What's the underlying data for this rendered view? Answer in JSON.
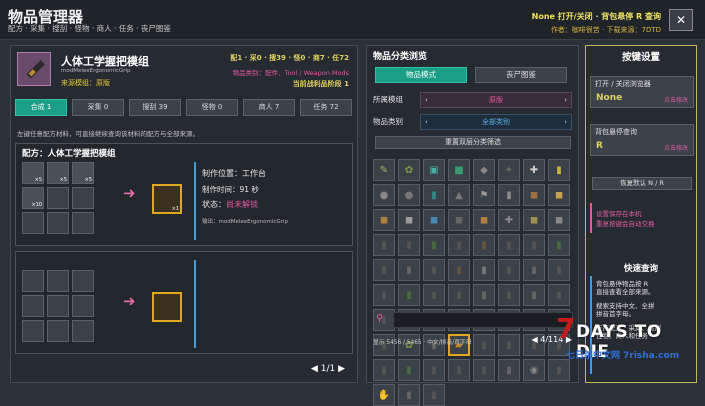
{
  "header": {
    "title": "物品管理器",
    "subtitle": "配方 · 采集 · 搜刮 · 怪物 · 商人 · 任务 · 丧尸图鉴",
    "hotkey": "None 打开/关闭 · 背包悬停 R 查询",
    "author": "作者：咖啡很苦 · 下载来源：7DTD",
    "close_label": "✕"
  },
  "item": {
    "name": "人体工学握把模组",
    "code": "modMeleeErgonomicGrip",
    "source": "来源模组：原版",
    "stats": "配1 · 采0 · 搜39 · 怪0 · 商7 · 任72",
    "category": "物品类别：配件、Tool / Weapon Mods",
    "stage": "当前战利品阶段 1"
  },
  "tabs": [
    {
      "label": "合成 1",
      "active": true
    },
    {
      "label": "采集 0",
      "active": false
    },
    {
      "label": "搜刮 39",
      "active": false
    },
    {
      "label": "怪物 0",
      "active": false
    },
    {
      "label": "商人 7",
      "active": false
    },
    {
      "label": "任务 72",
      "active": false
    }
  ],
  "hint": "左键任意配方材料，可直接继续查询该材料的配方与全部来源。",
  "recipe": {
    "title": "配方：人体工学握把模组",
    "ingredients": [
      {
        "count": "×5",
        "icon": "resource-icon"
      },
      {
        "count": "×5",
        "icon": "resource-icon"
      },
      {
        "count": "×5",
        "icon": "resource-icon"
      },
      {
        "count": "×10",
        "icon": "resource-icon"
      }
    ],
    "output_count": "×1",
    "location": "制作位置：工作台",
    "time": "制作时间：91 秒",
    "status_label": "状态：",
    "status_value": "尚未解锁",
    "output_code": "输出：modMeleeErgonomicGrip"
  },
  "pager": "1/1",
  "browser": {
    "title": "物品分类浏览",
    "mode_items": "物品模式",
    "mode_zombies": "丧尸图鉴",
    "module_label": "所属模组",
    "module_value": "原版",
    "category_label": "物品类别",
    "category_value": "全部类别",
    "reset_label": "重置双层分类筛选",
    "footer": "显示 5456 / 5465 · 中文/拼音/首字母",
    "page": "4/114"
  },
  "keys": {
    "title": "按键设置",
    "toggle_label": "打开 / 关闭浏览器",
    "toggle_value": "None",
    "toggle_mod": "点击修改",
    "query_label": "背包悬停查询",
    "query_value": "R",
    "query_mod": "点击修改",
    "reset_label": "恢复默认 N / R",
    "note1": "设置保存在本机",
    "note2": "重复按键会自动交换",
    "quick_title": "快速查询",
    "quick_lines": [
      "背包悬停物品按 R",
      "直接查看全部来源。",
      "",
      "搜索支持中文、全拼",
      "拼音首字母。",
      "",
      "支持配方、采集、搜刮",
      "怪物、商人和任务"
    ]
  },
  "logo": {
    "text": "DAYS TO DIE",
    "seven": "7",
    "site": "七日杀中文网 7risha.com"
  },
  "colors": {
    "accent": "#1b9e86",
    "highlight": "#e0d060",
    "pink": "#e05aa0",
    "blue": "#3f9fd8"
  }
}
